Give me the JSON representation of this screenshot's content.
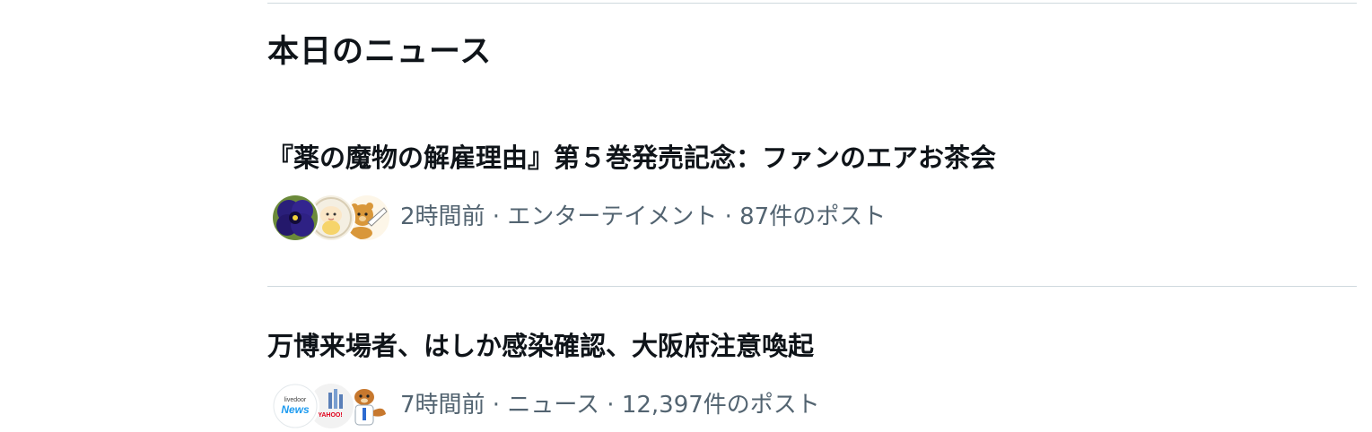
{
  "section": {
    "title": "本日のニュース"
  },
  "news": [
    {
      "headline": "『薬の魔物の解雇理由』第５巻発売記念：ファンのエアお茶会",
      "meta": "2時間前 · エンターテイメント · 87件のポスト",
      "avatars": [
        "pansy-flower-avatar",
        "cartoon-character-avatar",
        "bear-mascot-avatar"
      ]
    },
    {
      "headline": "万博来場者、はしか感染確認、大阪府注意喚起",
      "meta": "7時間前 · ニュース · 12,397件のポスト",
      "avatars": [
        "livedoor-news-avatar",
        "yahoo-news-avatar",
        "otter-mascot-avatar"
      ],
      "avatar_text": {
        "livedoor_small": "livedoor",
        "livedoor_big": "News",
        "yahoo": "YAHOO!"
      }
    }
  ],
  "colors": {
    "text_primary": "#0f1419",
    "text_secondary": "#536471",
    "divider": "#cfd9de",
    "livedoor_blue": "#1d9bf0"
  }
}
